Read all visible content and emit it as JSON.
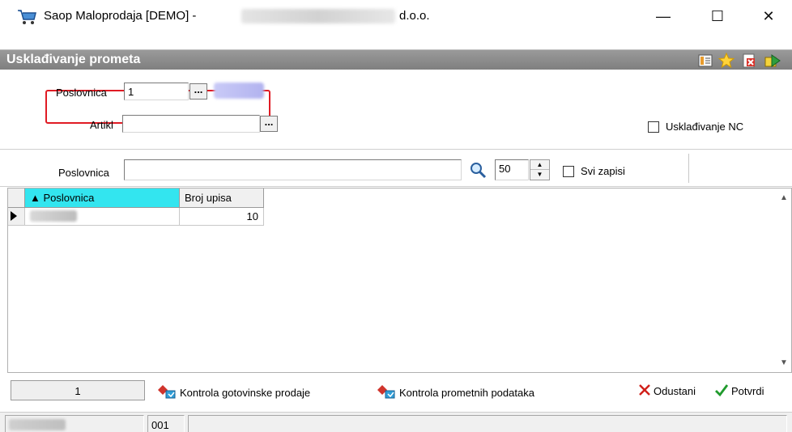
{
  "window": {
    "title": "Saop Maloprodaja [DEMO] -",
    "title_suffix": "d.o.o.",
    "controls": {
      "minimize": "—",
      "maximize": "☐",
      "close": "✕"
    }
  },
  "header": {
    "title": "Usklađivanje prometa",
    "icons": [
      "layout-icon",
      "star-icon",
      "close-doc-icon",
      "export-icon"
    ]
  },
  "form": {
    "poslovnica_label": "Poslovnica",
    "poslovnica_value": "1",
    "artikl_label": "Artikl",
    "artikl_value": "",
    "ellipsis": "...",
    "uskladivanje_nc_label": "Usklađivanje NC"
  },
  "search": {
    "label": "Poslovnica",
    "value": "",
    "count": "50",
    "svi_zapisi_label": "Svi zapisi"
  },
  "grid": {
    "columns": [
      "▲ Poslovnica",
      "Broj upisa"
    ],
    "rows": [
      {
        "poslovnica": "",
        "broj_upisa": "10"
      }
    ]
  },
  "bottom": {
    "count": "1",
    "kontrola_gotovinske": "Kontrola gotovinske prodaje",
    "kontrola_prometnih": "Kontrola prometnih podataka",
    "odustani": "Odustani",
    "potvrdi": "Potvrdi"
  },
  "status": {
    "panel2": "001"
  },
  "colors": {
    "header_bg": "#8a8a8a",
    "sorted_column": "#33e5ef",
    "highlight_border": "#e01b24"
  }
}
